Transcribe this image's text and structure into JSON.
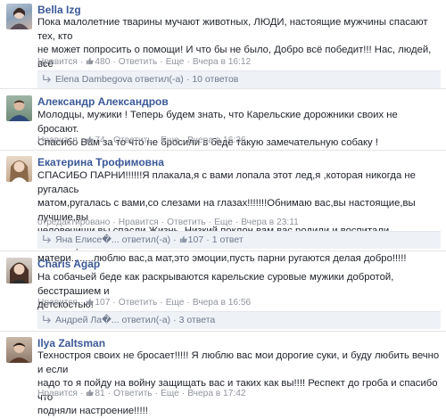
{
  "colors": {
    "link": "#3b5998",
    "meta": "#90949c",
    "reply_bar": "#eef1f6"
  },
  "icons": {
    "like": "thumbs-up-icon",
    "replies": "reply-arrow-icon"
  },
  "labels": {
    "like": "Нравится",
    "reply": "Ответить",
    "more": "Еще",
    "edited": "отредактировано"
  },
  "comments": [
    {
      "author": "Bella Izg",
      "text": "Пока малолетние тварины мучают животных, ЛЮДИ, настоящие мужчины спасают тех, кто\nне может попросить о помощи! И что бы не было, Добро всё победит!!! Нас, людей, всё\nравно больше, чем мразей!!",
      "likes": "480",
      "time": "Вчера в 16:12",
      "reply_user": "Elena Dambegova ответил(-а)",
      "reply_count": "10 ответов"
    },
    {
      "author": "Александр Александров",
      "text": "Молодцы, мужики ! Теперь будем знать, что Карельские дорожники своих не бросают.\nСпасибо Вам за то что не бросили в беде такую замечательную собаку !",
      "likes": "74",
      "time": "Вчера в 16:36"
    },
    {
      "author": "Екатерина Трофимовна",
      "text": "СПАСИБО ПАРНИ!!!!!!Я плакала,я с вами лопала этот лед,я ,которая никогда не ругалась\nматом,ругалась с вами,со слезами на глазах!!!!!!!Обнимаю вас,вы настоящие,вы лучшие,вы\nчеловечищи,вы спасли Жизнь. Низкий поклон вам,вас родили и воспитали настоящие\nматери........люблю вас,а мат,это эмоции,пусть парни ругаются делая добро!!!!!",
      "likes": "107",
      "time": "Вчера в 23:11",
      "reply_user": "Яна Елисе�... ответил(-а)",
      "reply_count": "1 ответ"
    },
    {
      "author": "Charis Agap",
      "text": "На собачьей беде как раскрываются карельские суровые мужики добротой, бесстрашием и\nдетскостью!",
      "likes": "107",
      "time": "Вчера в 16:56",
      "reply_user": "Андрей Ла�... ответил(-а)",
      "reply_count": "3 ответа"
    },
    {
      "author": "Ilya Zaltsman",
      "text": "Техностроя своих не бросает!!!!! Я люблю вас мои дорогие суки, и буду любить вечно и если\nнадо то я пойду на войну защищать вас и таких как вы!!!! Респект до гроба и спасибо что\nподняли настроение!!!!!",
      "likes": "81",
      "time": "Вчера в 17:42"
    }
  ]
}
